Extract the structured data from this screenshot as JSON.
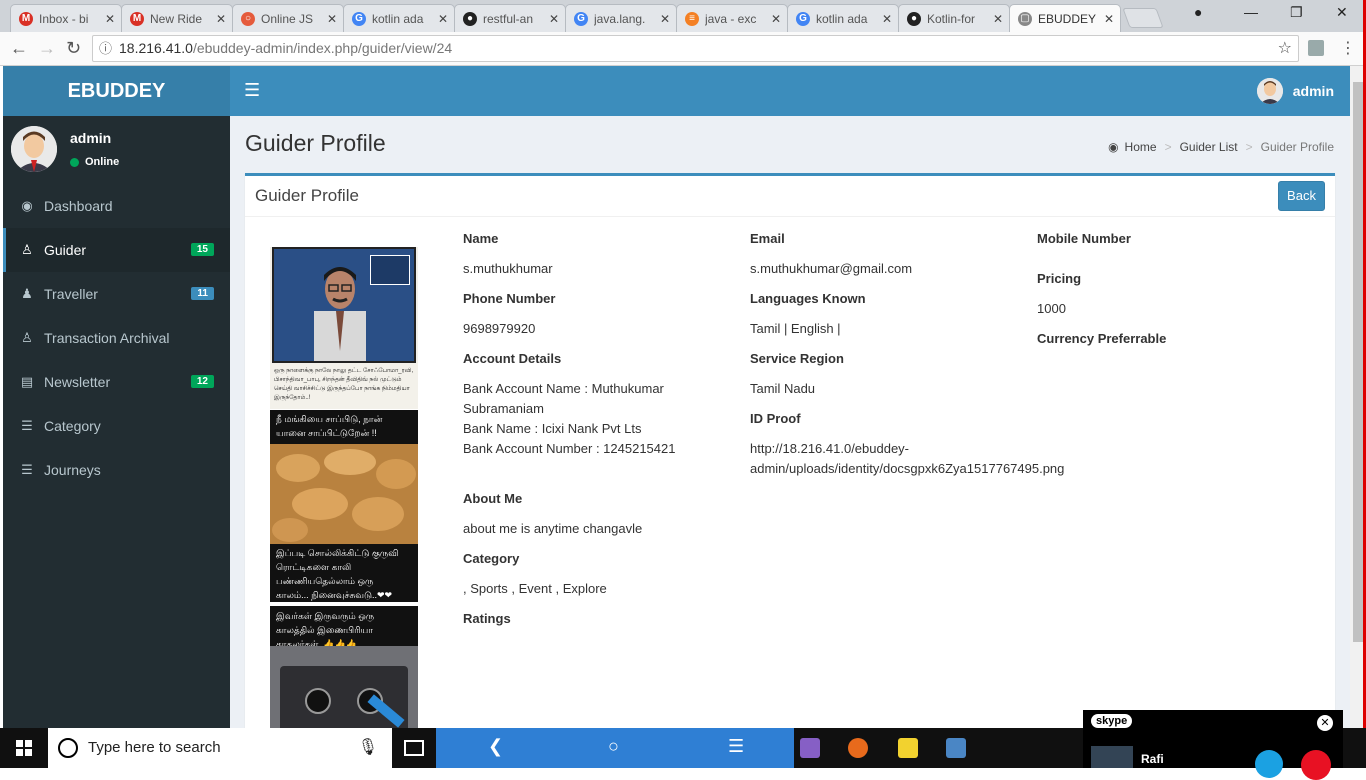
{
  "browser": {
    "tabs": [
      {
        "label": "Inbox - bi",
        "color": "#d93025",
        "icon": "M"
      },
      {
        "label": "New Ride",
        "color": "#d93025",
        "icon": "M"
      },
      {
        "label": "Online JS",
        "color": "#e55b3c",
        "icon": "○"
      },
      {
        "label": "kotlin ada",
        "color": "#4285f4",
        "icon": "G"
      },
      {
        "label": "restful-an",
        "color": "#222222",
        "icon": "●"
      },
      {
        "label": "java.lang.",
        "color": "#4285f4",
        "icon": "G"
      },
      {
        "label": "java - exc",
        "color": "#f48024",
        "icon": "≡"
      },
      {
        "label": "kotlin ada",
        "color": "#4285f4",
        "icon": "G"
      },
      {
        "label": "Kotlin-for",
        "color": "#222222",
        "icon": "●"
      },
      {
        "label": "EBUDDEY",
        "color": "#888888",
        "icon": "▢"
      }
    ],
    "url_host": "18.216.41.0",
    "url_path": "/ebuddey-admin/index.php/guider/view/24"
  },
  "app": {
    "brand": "EBUDDEY",
    "top_user": "admin"
  },
  "sidebar": {
    "user_name": "admin",
    "user_status": "Online",
    "items": [
      {
        "label": "Dashboard",
        "icon": "dashboard-icon",
        "glyph": "◉"
      },
      {
        "label": "Guider",
        "icon": "user-outline-icon",
        "glyph": "♙",
        "badge": "15",
        "badge_color": "#00a65a"
      },
      {
        "label": "Traveller",
        "icon": "user-icon",
        "glyph": "♟",
        "badge": "11",
        "badge_color": "#3c8dbc"
      },
      {
        "label": "Transaction Archival",
        "icon": "user-outline-icon",
        "glyph": "♙"
      },
      {
        "label": "Newsletter",
        "icon": "newspaper-icon",
        "glyph": "▤",
        "badge": "12",
        "badge_color": "#00a65a"
      },
      {
        "label": "Category",
        "icon": "list-icon",
        "glyph": "☰"
      },
      {
        "label": "Journeys",
        "icon": "list-icon",
        "glyph": "☰"
      }
    ]
  },
  "page": {
    "title": "Guider Profile",
    "breadcrumb": {
      "home": "Home",
      "list": "Guider List",
      "current": "Guider Profile"
    },
    "box_title": "Guider Profile",
    "back_label": "Back"
  },
  "profile": {
    "name_label": "Name",
    "name": "s.muthukhumar",
    "phone_label": "Phone Number",
    "phone": "9698979920",
    "account_label": "Account Details",
    "bank_name_line1": "Bank Account Name : Muthukumar",
    "bank_name_line2": "Subramaniam",
    "bank": "Bank Name : Icixi Nank Pvt Lts",
    "bank_number": "Bank Account Number : 1245215421",
    "about_label": "About Me",
    "about": "about me is anytime changavle",
    "category_label": "Category",
    "category": ", Sports , Event , Explore",
    "ratings_label": "Ratings",
    "email_label": "Email",
    "email": "s.muthukhumar@gmail.com",
    "languages_label": "Languages Known",
    "languages": "Tamil | English |",
    "region_label": "Service Region",
    "region": "Tamil Nadu",
    "idproof_label": "ID Proof",
    "idproof_line1": "http://18.216.41.0/ebuddey-",
    "idproof_line2": "admin/uploads/identity/docsgpxk6Zya1517767495.png",
    "mobile_label": "Mobile Number",
    "pricing_label": "Pricing",
    "pricing": "1000",
    "currency_label": "Currency Preferrable"
  },
  "photo_captions": {
    "meme1": "ஒரு நாளைக்கு நாலே நாலு தட்ட சோஃபோமா_ரவி, பிசாந்திவா_பாபு, சிறந்தன் தீவிதிவ் நல் முட்டும் செய்தி வாசிச்சிட்டு இருந்தப்போ நாங்க நிம்மதியா இருந்தோம்..!",
    "meme2_top1": "நீ மங்கியை சாப்பிடு, நான்",
    "meme2_top2": "யானை சாப்பிட்டுறேன் !!",
    "meme2_bottom1": "இப்படி சொல்லிக்கிட்டு குருவி",
    "meme2_bottom2": "ரொட்டிகளை காலி",
    "meme2_bottom3": "பண்ணியதெல்லாம் ஒரு",
    "meme2_bottom4": "காலம்... நினைவுச்சுவடு..❤❤",
    "meme3_1": "இவர்கள் இருவரும் ஒரு",
    "meme3_2": "காலத்தில் இணைபிரியா",
    "meme3_3": "காதலர்கள்..👍👍👍"
  },
  "taskbar": {
    "search_placeholder": "Type here to search",
    "skype_label": "skype",
    "skype_contact": "Rafi"
  }
}
